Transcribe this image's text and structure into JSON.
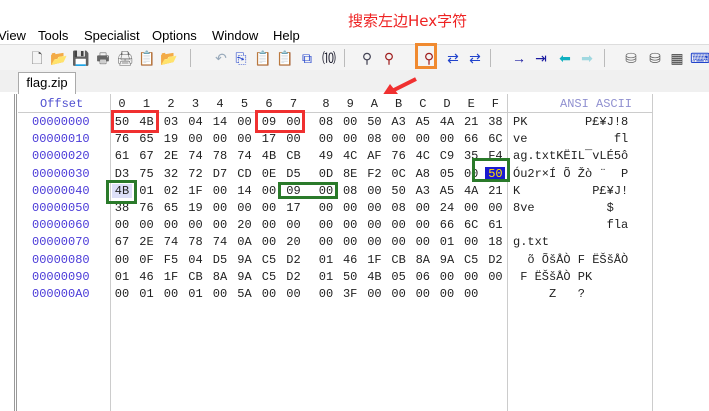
{
  "annotation": "搜索左边Hex字符",
  "menu": [
    "View",
    "Tools",
    "Specialist",
    "Options",
    "Window",
    "Help"
  ],
  "toolbar_icons": [
    "new-file",
    "open-folder",
    "save",
    "print-preview",
    "print",
    "properties",
    "open-recent",
    "undo",
    "copy",
    "paste",
    "paste-special",
    "compare",
    "binary-convert",
    "find",
    "find-text",
    "find-hex",
    "replace",
    "replace-hex",
    "goto",
    "goto-offset",
    "back",
    "forward",
    "disk",
    "disks",
    "ram",
    "keyboard"
  ],
  "tab": {
    "label": "flag.zip"
  },
  "header": {
    "offset": "Offset",
    "columns": [
      "0",
      "1",
      "2",
      "3",
      "4",
      "5",
      "6",
      "7",
      "8",
      "9",
      "A",
      "B",
      "C",
      "D",
      "E",
      "F"
    ],
    "ascii": "ANSI ASCII"
  },
  "rows": [
    {
      "offset": "00000000",
      "bytes": [
        "50",
        "4B",
        "03",
        "04",
        "14",
        "00",
        "09",
        "00",
        "08",
        "00",
        "50",
        "A3",
        "A5",
        "4A",
        "21",
        "38"
      ],
      "ascii": "PK        P£¥J!8"
    },
    {
      "offset": "00000010",
      "bytes": [
        "76",
        "65",
        "19",
        "00",
        "00",
        "00",
        "17",
        "00",
        "00",
        "00",
        "08",
        "00",
        "00",
        "00",
        "66",
        "6C"
      ],
      "ascii": "ve            fl"
    },
    {
      "offset": "00000020",
      "bytes": [
        "61",
        "67",
        "2E",
        "74",
        "78",
        "74",
        "4B",
        "CB",
        "49",
        "4C",
        "AF",
        "76",
        "4C",
        "C9",
        "35",
        "F4"
      ],
      "ascii": "ag.txtKËIL¯vLÉ5ô"
    },
    {
      "offset": "00000030",
      "bytes": [
        "D3",
        "75",
        "32",
        "72",
        "D7",
        "CD",
        "0E",
        "D5",
        "0D",
        "8E",
        "F2",
        "0C",
        "A8",
        "05",
        "00",
        "50"
      ],
      "ascii": "Óu2r×Í Õ Žò ¨  P"
    },
    {
      "offset": "00000040",
      "bytes": [
        "4B",
        "01",
        "02",
        "1F",
        "00",
        "14",
        "00",
        "09",
        "00",
        "08",
        "00",
        "50",
        "A3",
        "A5",
        "4A",
        "21"
      ],
      "ascii": "K          P£¥J!"
    },
    {
      "offset": "00000050",
      "bytes": [
        "38",
        "76",
        "65",
        "19",
        "00",
        "00",
        "00",
        "17",
        "00",
        "00",
        "00",
        "08",
        "00",
        "24",
        "00",
        "00"
      ],
      "ascii": "8ve          $  "
    },
    {
      "offset": "00000060",
      "bytes": [
        "00",
        "00",
        "00",
        "00",
        "00",
        "20",
        "00",
        "00",
        "00",
        "00",
        "00",
        "00",
        "00",
        "66",
        "6C",
        "61"
      ],
      "ascii": "             fla"
    },
    {
      "offset": "00000070",
      "bytes": [
        "67",
        "2E",
        "74",
        "78",
        "74",
        "0A",
        "00",
        "20",
        "00",
        "00",
        "00",
        "00",
        "00",
        "01",
        "00",
        "18"
      ],
      "ascii": "g.txt           "
    },
    {
      "offset": "00000080",
      "bytes": [
        "00",
        "0F",
        "F5",
        "04",
        "D5",
        "9A",
        "C5",
        "D2",
        "01",
        "46",
        "1F",
        "CB",
        "8A",
        "9A",
        "C5",
        "D2"
      ],
      "ascii": "  õ ÕšÅÒ F ËŠšÅÒ"
    },
    {
      "offset": "00000090",
      "bytes": [
        "01",
        "46",
        "1F",
        "CB",
        "8A",
        "9A",
        "C5",
        "D2",
        "01",
        "50",
        "4B",
        "05",
        "06",
        "00",
        "00",
        "00"
      ],
      "ascii": " F ËŠšÅÒ PK     "
    },
    {
      "offset": "000000A0",
      "bytes": [
        "00",
        "01",
        "00",
        "01",
        "00",
        "5A",
        "00",
        "00",
        "00",
        "3F",
        "00",
        "00",
        "00",
        "00",
        "00"
      ],
      "ascii": "     Z   ?"
    }
  ],
  "colors": {
    "annotation": "#ee2222",
    "highlight_red": "#f03030",
    "highlight_green": "#2a7a2a",
    "selection": "#1a1ad0",
    "hex_box": "#f08a30"
  }
}
